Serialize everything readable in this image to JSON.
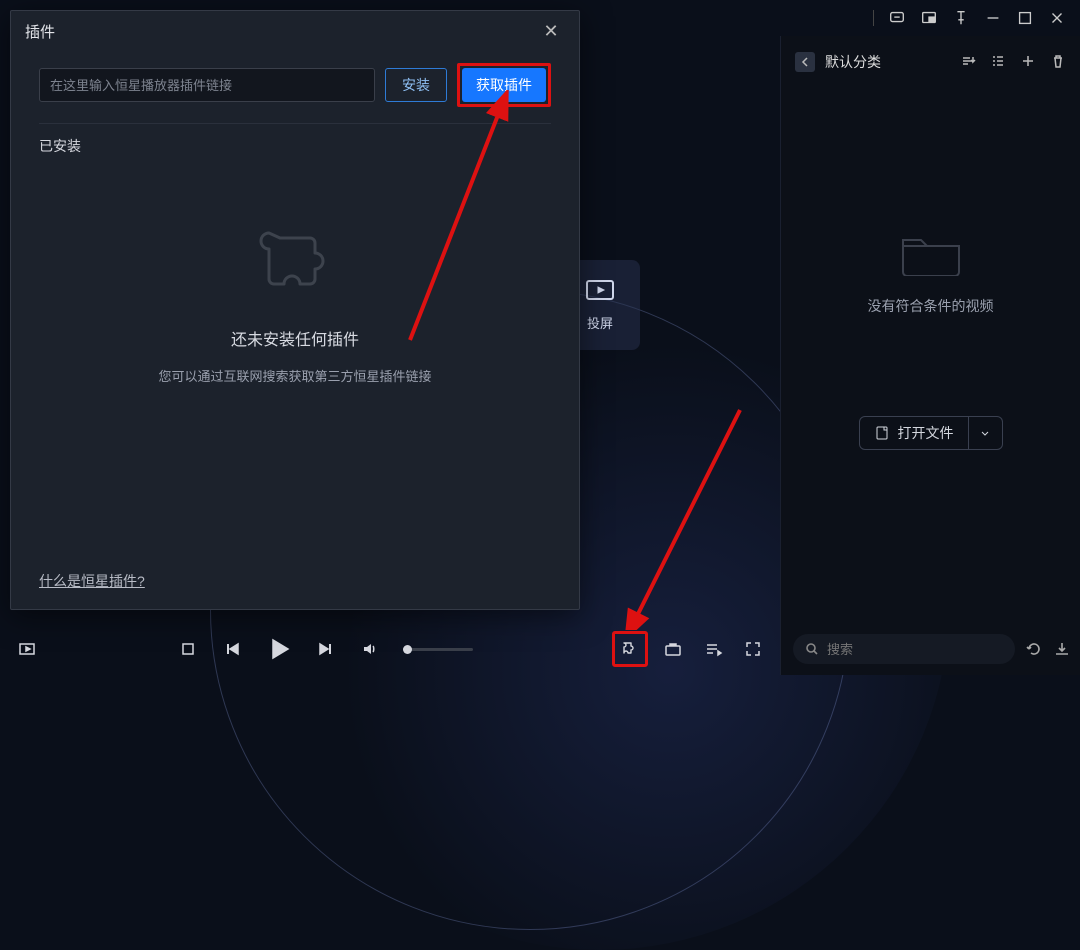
{
  "titlebar": {},
  "cast_tile": {
    "label": "投屏"
  },
  "dialog": {
    "title": "插件",
    "input_placeholder": "在这里输入恒星播放器插件链接",
    "install_label": "安装",
    "get_plugin_label": "获取插件",
    "installed_label": "已安装",
    "empty_title": "还未安装任何插件",
    "empty_sub": "您可以通过互联网搜索获取第三方恒星插件链接",
    "what_is_link": "什么是恒星插件?"
  },
  "right_panel": {
    "category_label": "默认分类",
    "empty_msg": "没有符合条件的视频",
    "open_file_label": "打开文件",
    "search_placeholder": "搜索"
  }
}
